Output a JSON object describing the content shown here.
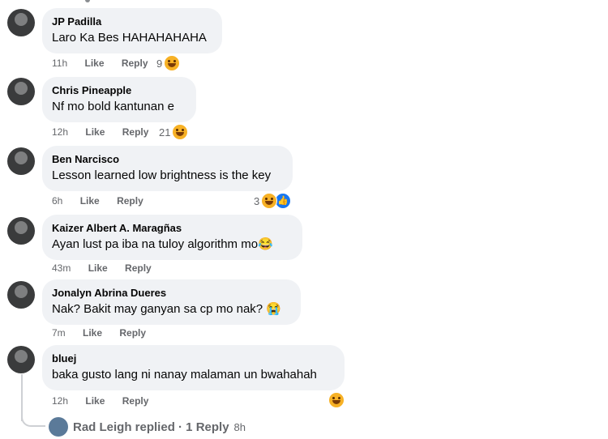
{
  "comments": [
    {
      "author": "JP Padilla",
      "text": "Laro Ka Bes HAHAHAHAHA",
      "time": "11h",
      "like": "Like",
      "reply": "Reply",
      "reaction_count": "9",
      "reaction": "haha-icon"
    },
    {
      "author": "Chris Pineapple",
      "text": "Nf mo bold kantunan e",
      "time": "12h",
      "like": "Like",
      "reply": "Reply",
      "reaction_count": "21",
      "reaction": "haha-icon"
    },
    {
      "author": "Ben Narcisco",
      "text": "Lesson learned low brightness is the key",
      "time": "6h",
      "like": "Like",
      "reply": "Reply",
      "reaction_count": "3",
      "reaction": "haha-icon"
    },
    {
      "author": "Kaizer Albert A. Maragñas",
      "text": "Ayan lust pa iba na tuloy algorithm mo😂",
      "time": "43m",
      "like": "Like",
      "reply": "Reply"
    },
    {
      "author": "Jonalyn Abrina Dueres",
      "text": "Nak? Bakit may ganyan sa cp mo nak? 😭",
      "time": "7m",
      "like": "Like",
      "reply": "Reply"
    },
    {
      "author": "bluej",
      "text": "baka gusto lang ni nanay malaman un bwahahah",
      "time": "12h",
      "like": "Like",
      "reply": "Reply"
    }
  ],
  "reply_summary": {
    "text": "Rad Leigh replied · 1 Reply",
    "time": "8h"
  },
  "colors": {
    "bubble": "#f0f2f5",
    "meta": "#65676b",
    "like_blue": "#1877f2",
    "haha": "#f7b125"
  }
}
